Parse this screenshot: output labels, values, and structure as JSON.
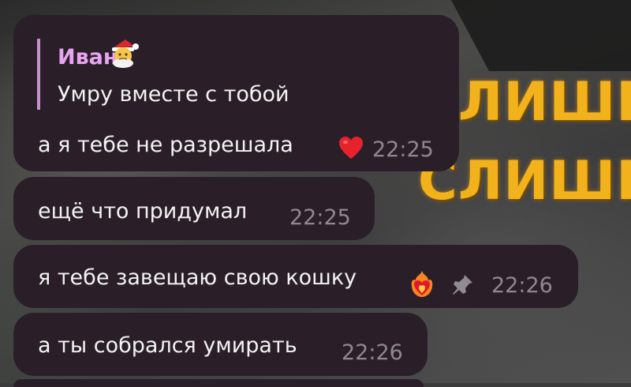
{
  "messages": [
    {
      "reply": {
        "author": "Иван",
        "author_emoji": "santa-face-emoji",
        "text": "Умру вместе с тобой"
      },
      "text": "а я тебе не разрешала",
      "reaction": "red-heart",
      "time": "22:25"
    },
    {
      "text": "ещё что придумал",
      "time": "22:25"
    },
    {
      "text": "я тебе завещаю свою кошку",
      "reaction": "heart-on-fire",
      "pinned": true,
      "time": "22:26"
    },
    {
      "text": "а ты собрался умирать",
      "time": "22:26"
    }
  ],
  "wallpaper": {
    "line1": "СЛИШК",
    "line2": "СЛИШК",
    "text_color": "#f2b21c"
  },
  "colors": {
    "bubble": "#2a1f29",
    "reply_accent": "#c58fd0",
    "reply_name": "#e7a4f0",
    "time": "#8e8891"
  }
}
